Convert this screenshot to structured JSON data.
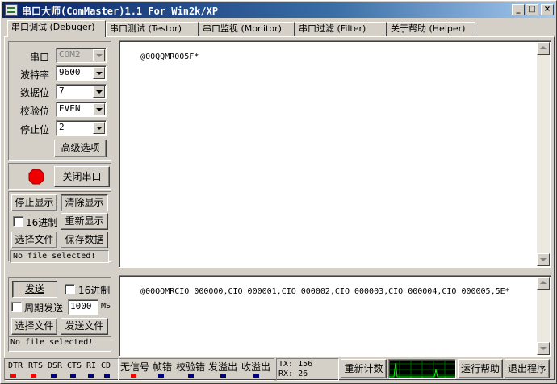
{
  "window": {
    "title": "串口大师(ComMaster)1.1 For Win2k/XP",
    "min": "_",
    "max": "□",
    "close": "×"
  },
  "tabs": [
    {
      "label": "串口调试 (Debuger)"
    },
    {
      "label": "串口测试 (Testor)"
    },
    {
      "label": "串口监视 (Monitor)"
    },
    {
      "label": "串口过滤 (Filter)"
    },
    {
      "label": "关于帮助 (Helper)"
    }
  ],
  "settings": {
    "port_label": "串口",
    "port_value": "COM2",
    "baud_label": "波特率",
    "baud_value": "9600",
    "databits_label": "数据位",
    "databits_value": "7",
    "parity_label": "校验位",
    "parity_value": "EVEN",
    "stopbits_label": "停止位",
    "stopbits_value": "2",
    "advanced_button": "高级选项"
  },
  "port_control": {
    "close_button": "关闭串口",
    "indicator_color": "#ee0000"
  },
  "receive_controls": {
    "stop_display": "停止显示",
    "clear_display": "清除显示",
    "hex_label": "16进制",
    "redisplay": "重新显示",
    "select_file": "选择文件",
    "save_data": "保存数据",
    "file_status": "No file selected!"
  },
  "receive_text": "@00QQMR005F*",
  "send_text": "@00QQMRCIO 000000,CIO 000001,CIO 000002,CIO 000003,CIO 000004,CIO 000005,5E*",
  "send_controls": {
    "send_button": "发送",
    "hex_label": "16进制",
    "periodic_label": "周期发送",
    "period_value": "1000",
    "period_unit": "MS",
    "select_file": "选择文件",
    "send_file": "发送文件",
    "file_status": "No file selected!"
  },
  "statusbar": {
    "signals": [
      {
        "label": "DTR",
        "color": "#ff0000"
      },
      {
        "label": "RTS",
        "color": "#ff0000"
      },
      {
        "label": "DSR",
        "color": "#000080"
      },
      {
        "label": "CTS",
        "color": "#000080"
      },
      {
        "label": "RI",
        "color": "#000080"
      },
      {
        "label": "CD",
        "color": "#000080"
      }
    ],
    "errors": [
      {
        "label": "无信号",
        "color": "#ff0000"
      },
      {
        "label": "帧错",
        "color": "#000080"
      },
      {
        "label": "校验错",
        "color": "#000080"
      },
      {
        "label": "发溢出",
        "color": "#000080"
      },
      {
        "label": "收溢出",
        "color": "#000080"
      }
    ],
    "tx": "TX: 156",
    "rx": "RX: 26",
    "recount_button": "重新计数",
    "help_button": "运行帮助",
    "exit_button": "退出程序"
  }
}
